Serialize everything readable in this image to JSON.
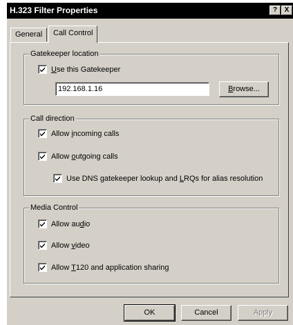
{
  "window": {
    "title": "H.323 Filter Properties",
    "help_button": "?",
    "close_button": "X"
  },
  "tabs": [
    {
      "label": "General"
    },
    {
      "label": "Call Control"
    }
  ],
  "gatekeeper": {
    "legend": "Gatekeeper location",
    "use_gatekeeper": {
      "label_pre": "",
      "label_u": "U",
      "label_post": "se this Gatekeeper",
      "checked": true
    },
    "address": "192.168.1.16",
    "browse": {
      "label_u": "B",
      "label_post": "rowse..."
    }
  },
  "call_direction": {
    "legend": "Call direction",
    "incoming": {
      "label_pre": "Allow ",
      "label_u": "i",
      "label_post": "ncoming calls",
      "checked": true
    },
    "outgoing": {
      "label_pre": "Allow ",
      "label_u": "o",
      "label_post": "utgoing calls",
      "checked": true
    },
    "dns": {
      "label_pre": "Use DNS gatekeeper lookup and ",
      "label_u": "L",
      "label_post": "RQs for alias resolution",
      "checked": true
    }
  },
  "media_control": {
    "legend": "Media Control",
    "audio": {
      "label_pre": "Allow au",
      "label_u": "d",
      "label_post": "io",
      "checked": true
    },
    "video": {
      "label_pre": "Allow ",
      "label_u": "v",
      "label_post": "ideo",
      "checked": true
    },
    "t120": {
      "label_pre": "Allow ",
      "label_u": "T",
      "label_post": "120 and application sharing",
      "checked": true
    }
  },
  "buttons": {
    "ok": "OK",
    "cancel": "Cancel",
    "apply": "Apply"
  }
}
